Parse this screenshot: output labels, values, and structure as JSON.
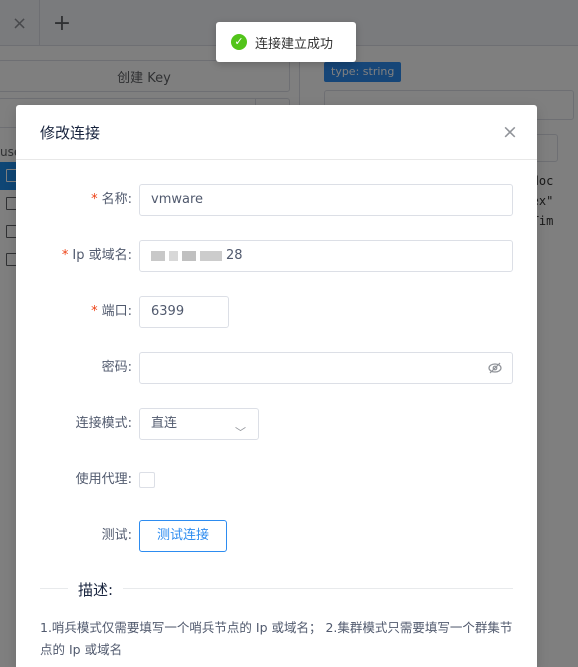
{
  "toast": {
    "text": "连接建立成功",
    "icon": "check-circle-icon"
  },
  "background": {
    "tab_close": "×",
    "tab_add": "+",
    "create_key": "创建 Key",
    "tree_prefix": "use",
    "type_badge": "type: string",
    "code_lines": [
      "ng.doc",
      ",\"sex\"",
      "ateTim"
    ]
  },
  "modal": {
    "title": "修改连接",
    "close": "×",
    "fields": {
      "name": {
        "label": "名称:",
        "value": "vmware",
        "required": true
      },
      "host": {
        "label": "Ip 或域名:",
        "value_suffix": "28",
        "required": true
      },
      "port": {
        "label": "端口:",
        "value": "6399",
        "required": true
      },
      "password": {
        "label": "密码:",
        "value": ""
      },
      "mode": {
        "label": "连接模式:",
        "value": "直连"
      },
      "proxy": {
        "label": "使用代理:",
        "checked": false
      },
      "test": {
        "label": "测试:",
        "button": "测试连接"
      }
    },
    "section_title": "描述:",
    "description": "1.哨兵模式仅需要填写一个哨兵节点的 Ip 或域名；  2.集群模式只需要填写一个群集节点的 Ip 或域名"
  },
  "colors": {
    "primary": "#2d8cf0",
    "success": "#52c41a",
    "required": "#ed4014"
  }
}
